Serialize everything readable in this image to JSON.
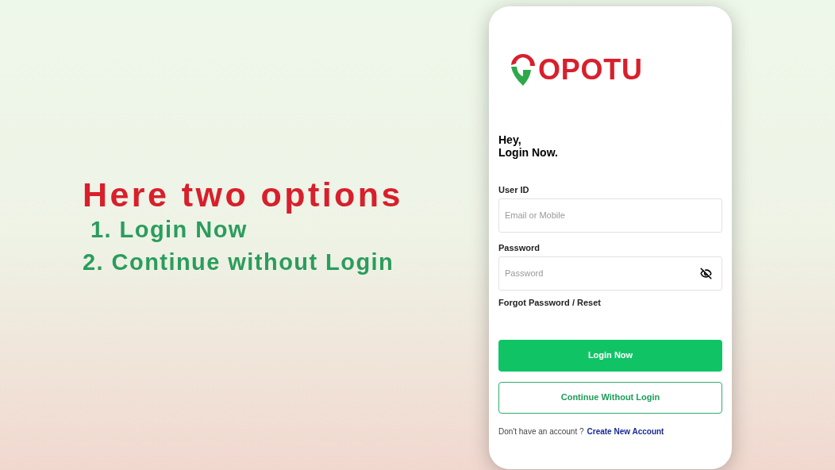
{
  "promo": {
    "heading": "Here two options",
    "options": [
      "1. Login Now",
      "2. Continue without Login"
    ]
  },
  "app": {
    "logo_text": "OPOTU",
    "greeting": "Hey,",
    "subtitle": "Login Now.",
    "fields": [
      {
        "label": "User ID",
        "placeholder": "Email or Mobile",
        "kind": "text"
      },
      {
        "label": "Password",
        "placeholder": "Password",
        "kind": "password",
        "password_visible": false
      }
    ],
    "forgot_link": "Forgot Password / Reset",
    "buttons": [
      {
        "label": "Login Now",
        "kind": "primary"
      },
      {
        "label": "Continue Without Login",
        "kind": "outline"
      }
    ],
    "signup_prompt": "Don't have an account ?",
    "signup_link": "Create New Account"
  }
}
